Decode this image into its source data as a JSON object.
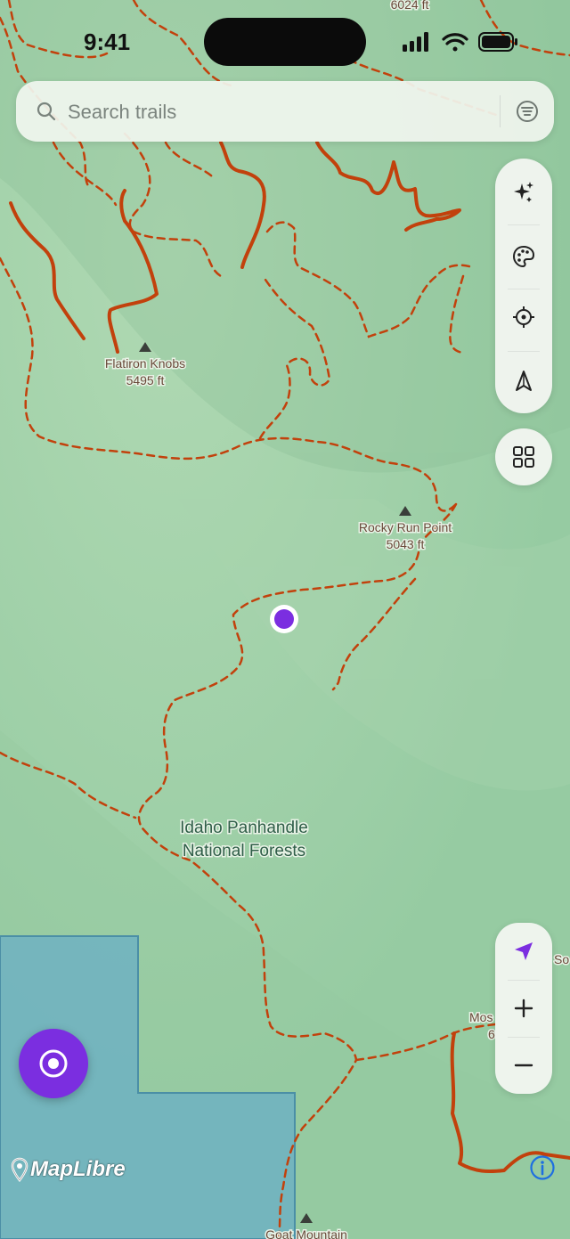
{
  "status_bar": {
    "time": "9:41"
  },
  "search": {
    "placeholder": "Search trails"
  },
  "map": {
    "peaks": [
      {
        "name": "Flatiron Knobs",
        "elevation": "5495 ft"
      },
      {
        "name": "Rocky Run Point",
        "elevation": "5043 ft"
      },
      {
        "name": "Goat Mountain",
        "elevation": ""
      }
    ],
    "area_label_line1": "Idaho Panhandle",
    "area_label_line2": "National Forests",
    "partial_labels": {
      "top_elevation": "6024 ft",
      "right_so": "So",
      "right_mos": "Mos",
      "right_digit": "6"
    }
  },
  "attribution": {
    "provider": "MapLibre"
  },
  "colors": {
    "accent": "#7b2ee0",
    "trail": "#c2410c",
    "terrain": "#9ccfa5",
    "water": "#6fb4c4"
  },
  "icons": {
    "search": "search-icon",
    "filter": "filter-icon",
    "sparkle": "sparkle-icon",
    "palette": "palette-icon",
    "locate": "crosshair-icon",
    "compass": "compass-icon",
    "layers": "grid-icon",
    "navigation": "navigation-arrow-icon",
    "zoom_in": "plus-icon",
    "zoom_out": "minus-icon",
    "record": "record-icon",
    "info": "info-icon"
  }
}
